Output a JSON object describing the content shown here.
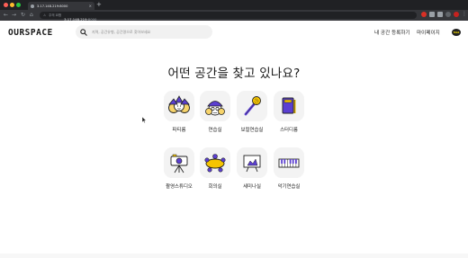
{
  "browser": {
    "tab_title": "3.17.148.219:8000",
    "tab_close": "×",
    "new_tab": "+",
    "back": "←",
    "forward": "→",
    "reload": "↻",
    "home": "⌂",
    "security_icon": "warning-icon",
    "security_label": "주의 요함",
    "url_host": "3.17.148.219",
    "url_port": ":8000"
  },
  "header": {
    "logo": "OURSPACE",
    "search_placeholder": "지역, 공간유형, 공간명으로 찾아보세요",
    "register_link": "내 공간 등록하기",
    "mypage_link": "마이페이지",
    "kakao_label": "TALK"
  },
  "main": {
    "headline": "어떤 공간을 찾고 있나요?",
    "categories": [
      {
        "label": "파티룸",
        "icon": "party-room-icon"
      },
      {
        "label": "연습실",
        "icon": "practice-room-icon"
      },
      {
        "label": "보컬연습실",
        "icon": "vocal-room-icon"
      },
      {
        "label": "스터디룸",
        "icon": "study-room-icon"
      },
      {
        "label": "촬영스튜디오",
        "icon": "studio-icon"
      },
      {
        "label": "회의실",
        "icon": "meeting-room-icon"
      },
      {
        "label": "세미나실",
        "icon": "seminar-room-icon"
      },
      {
        "label": "악기연습실",
        "icon": "instrument-room-icon"
      }
    ]
  },
  "colors": {
    "accent_purple": "#5b3fd1",
    "accent_yellow": "#f5c400",
    "tile_bg": "#f3f3f3"
  }
}
